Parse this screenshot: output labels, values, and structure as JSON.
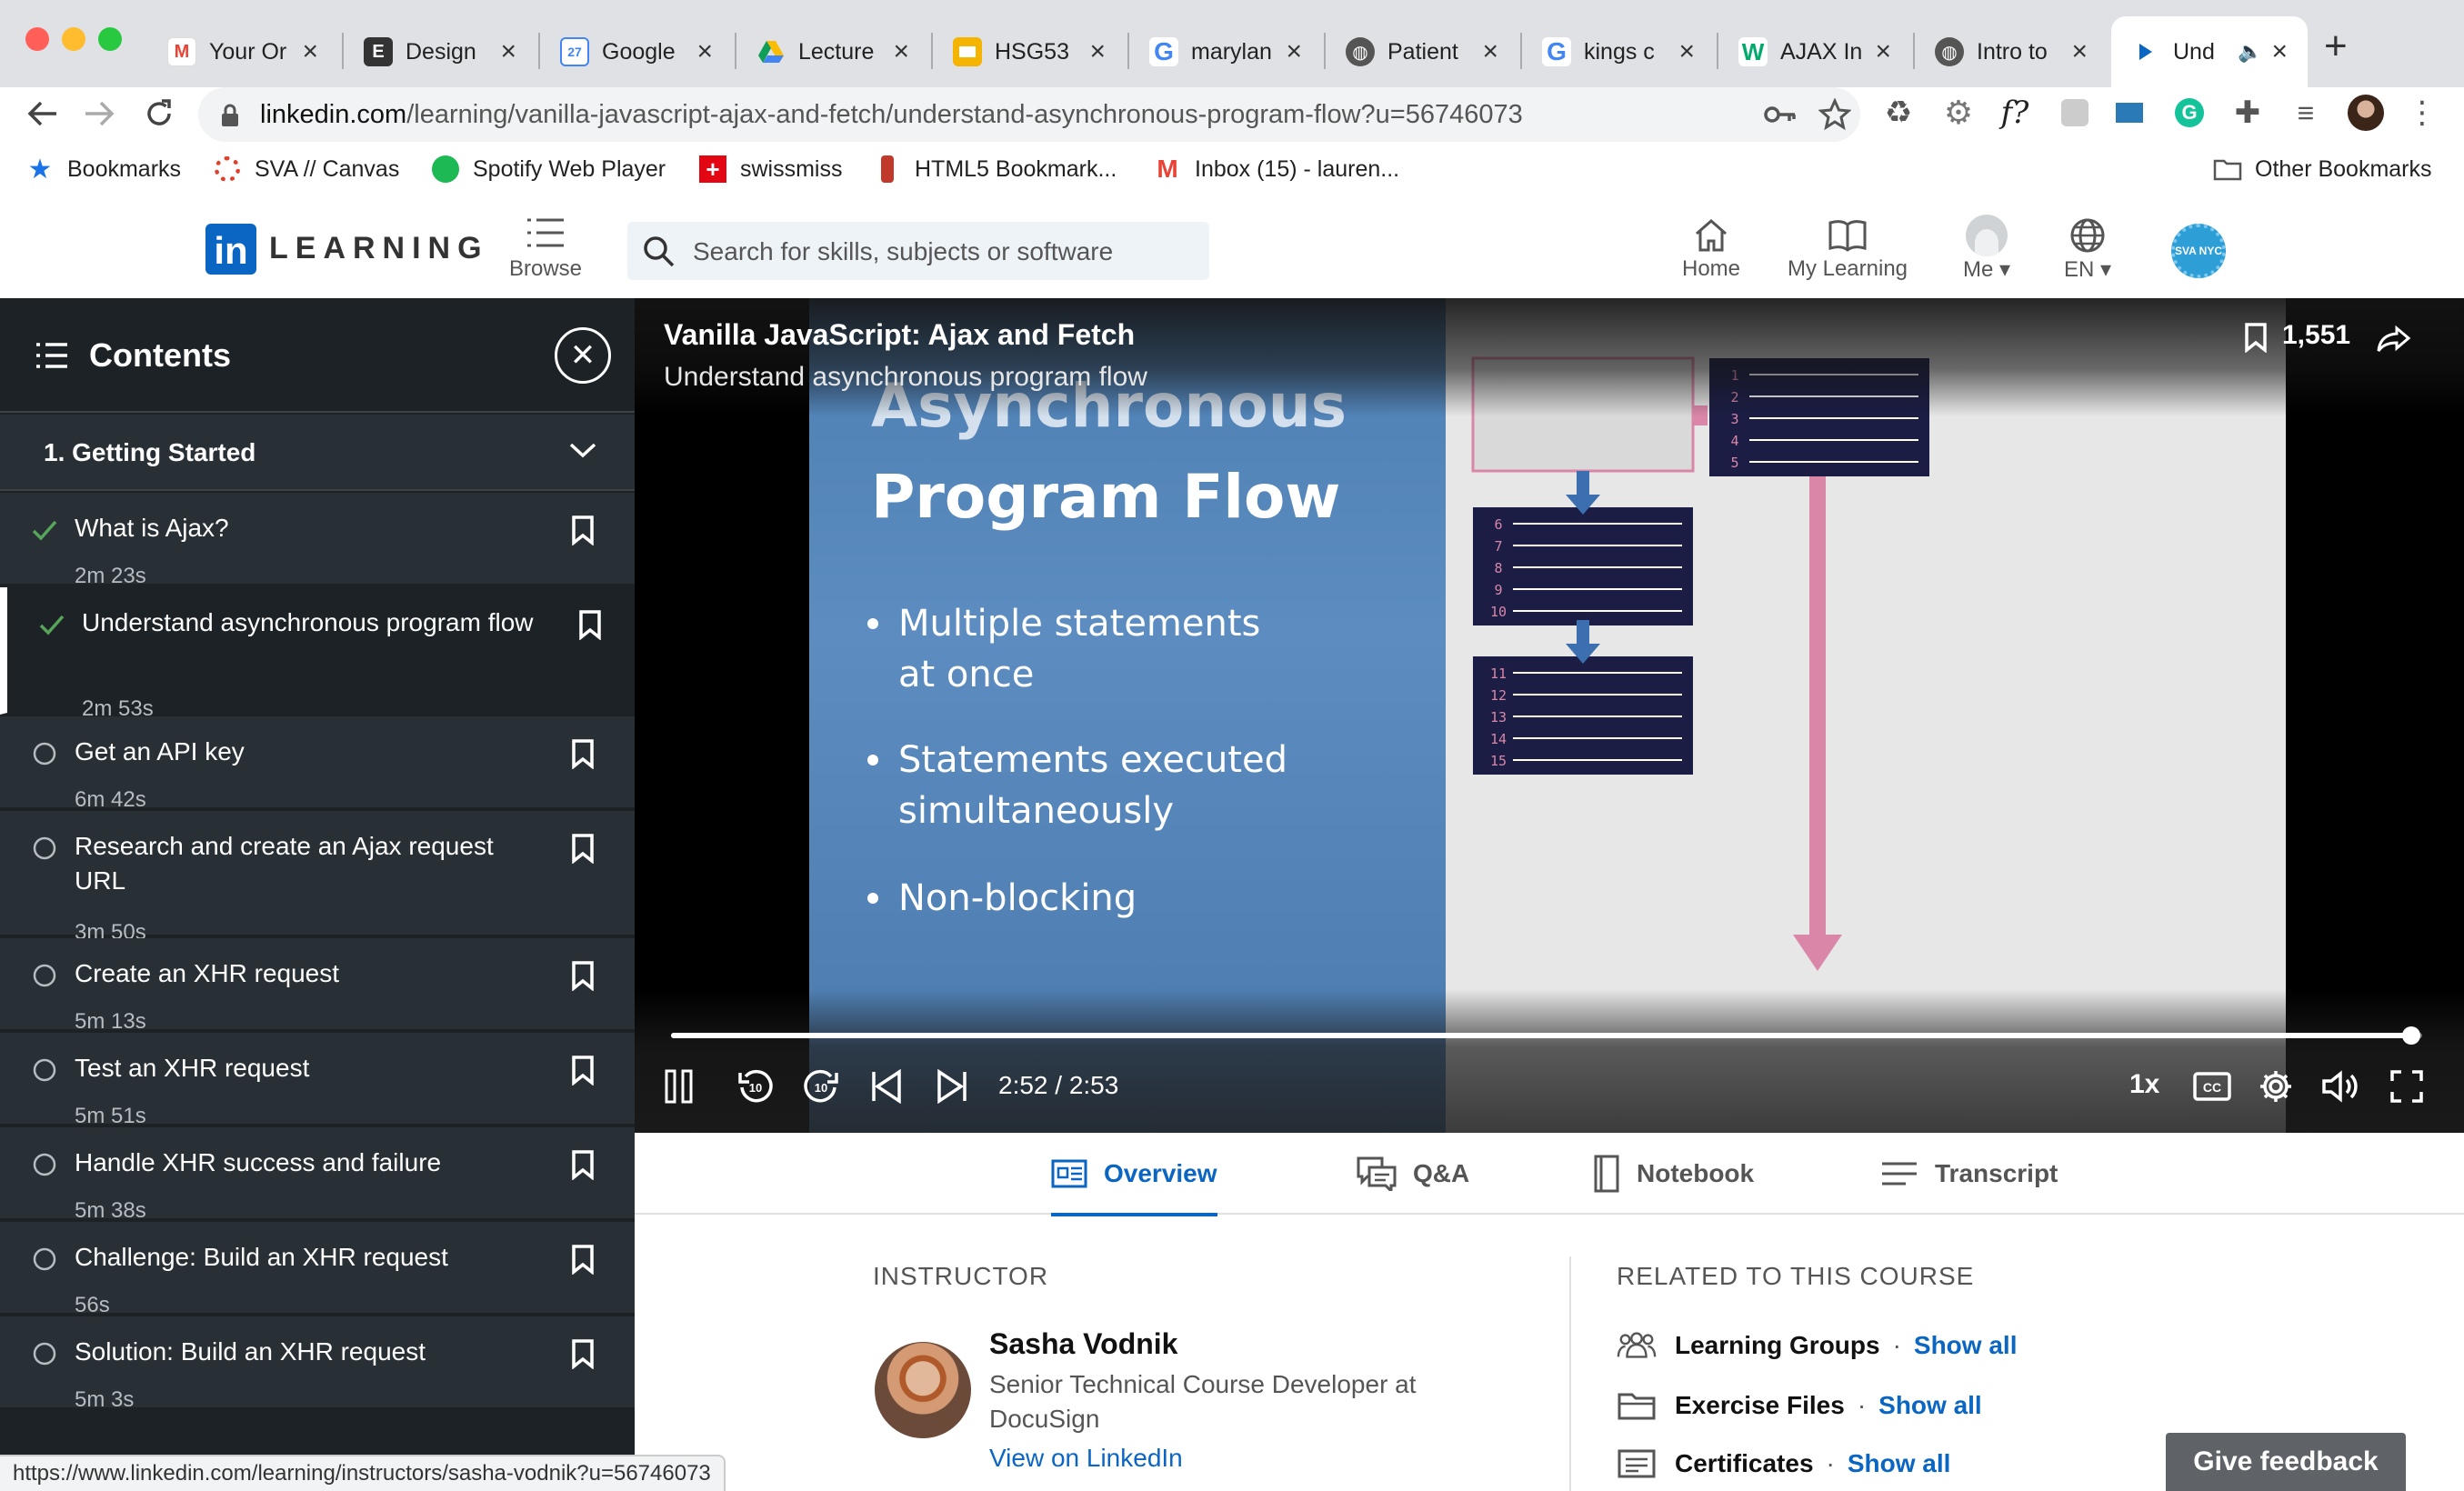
{
  "browser": {
    "tabs": [
      {
        "label": "Your Or",
        "icon": "gmail-icon",
        "color": "#ea4335"
      },
      {
        "label": "Design",
        "icon": "eater-icon",
        "color": "#333333"
      },
      {
        "label": "Google",
        "icon": "google-calendar-icon",
        "color": "#4285f4"
      },
      {
        "label": "Lecture",
        "icon": "google-drive-icon",
        "color": "#fbbc04"
      },
      {
        "label": "HSG53",
        "icon": "google-slides-icon",
        "color": "#f4b400"
      },
      {
        "label": "marylan",
        "icon": "google-icon",
        "color": "#4285f4"
      },
      {
        "label": "Patient",
        "icon": "globe-icon",
        "color": "#444444"
      },
      {
        "label": "kings c",
        "icon": "google-icon",
        "color": "#4285f4"
      },
      {
        "label": "AJAX In",
        "icon": "w3schools-icon",
        "color": "#04aa6d"
      },
      {
        "label": "Intro to",
        "icon": "globe-icon",
        "color": "#444444"
      },
      {
        "label": "Und",
        "icon": "linkedin-learning-icon",
        "color": "#0a66c2"
      }
    ],
    "url_host": "linkedin.com",
    "url_path": "/learning/vanilla-javascript-ajax-and-fetch/understand-asynchronous-program-flow?u=56746073",
    "bookmarks": [
      {
        "label": "Bookmarks",
        "icon": "star-icon"
      },
      {
        "label": "SVA // Canvas",
        "icon": "canvas-icon"
      },
      {
        "label": "Spotify Web Player",
        "icon": "spotify-icon"
      },
      {
        "label": "swissmiss",
        "icon": "swiss-flag-icon"
      },
      {
        "label": "HTML5 Bookmark...",
        "icon": "bookmarklet-icon"
      },
      {
        "label": "Inbox (15) - lauren...",
        "icon": "gmail-icon"
      },
      {
        "label": "Other Bookmarks",
        "icon": "folder-icon"
      }
    ],
    "status_url": "https://www.linkedin.com/learning/instructors/sasha-vodnik?u=56746073"
  },
  "header": {
    "logo_in": "in",
    "logo_word": "LEARNING",
    "browse": "Browse",
    "search_placeholder": "Search for skills, subjects or software",
    "nav": [
      {
        "label": "Home",
        "icon": "home-icon"
      },
      {
        "label": "My Learning",
        "icon": "book-icon"
      },
      {
        "label": "Me",
        "icon": "avatar-icon"
      },
      {
        "label": "EN",
        "icon": "globe-icon"
      }
    ],
    "org_badge": "SVA NYC"
  },
  "sidebar": {
    "title": "Contents",
    "chapter": "1. Getting Started",
    "lessons": [
      {
        "title": "What is Ajax?",
        "duration": "2m 23s",
        "status": "complete"
      },
      {
        "title": "Understand asynchronous program flow",
        "duration": "2m 53s",
        "status": "complete"
      },
      {
        "title": "Get an API key",
        "duration": "6m 42s",
        "status": "incomplete"
      },
      {
        "title": "Research and create an Ajax request URL",
        "duration": "3m 50s",
        "status": "incomplete"
      },
      {
        "title": "Create an XHR request",
        "duration": "5m 13s",
        "status": "incomplete"
      },
      {
        "title": "Test an XHR request",
        "duration": "5m 51s",
        "status": "incomplete"
      },
      {
        "title": "Handle XHR success and failure",
        "duration": "5m 38s",
        "status": "incomplete"
      },
      {
        "title": "Challenge: Build an XHR request",
        "duration": "56s",
        "status": "incomplete"
      },
      {
        "title": "Solution: Build an XHR request",
        "duration": "5m 3s",
        "status": "incomplete"
      }
    ]
  },
  "player": {
    "course_title": "Vanilla JavaScript: Ajax and Fetch",
    "video_title": "Understand asynchronous program flow",
    "saves_count": "1,551",
    "slide": {
      "heading_1": "Asynchronous",
      "heading_2": "Program Flow",
      "bullets": [
        [
          "Multiple statements",
          "at once"
        ],
        [
          "Statements executed",
          "simultaneously"
        ],
        [
          "Non-blocking"
        ]
      ],
      "line_numbers": [
        "1",
        "2",
        "3",
        "4",
        "5",
        "6",
        "7",
        "8",
        "9",
        "10",
        "11",
        "12",
        "13",
        "14",
        "15"
      ]
    },
    "time": "2:52 / 2:53",
    "progress_fraction": 0.994,
    "speed": "1x"
  },
  "content_tabs": [
    {
      "label": "Overview",
      "icon": "overview-icon",
      "active": true
    },
    {
      "label": "Q&A",
      "icon": "qa-icon",
      "active": false
    },
    {
      "label": "Notebook",
      "icon": "notebook-icon",
      "active": false
    },
    {
      "label": "Transcript",
      "icon": "transcript-icon",
      "active": false
    }
  ],
  "overview": {
    "instructor_heading": "INSTRUCTOR",
    "instructor_name": "Sasha Vodnik",
    "instructor_role": "Senior Technical Course Developer at DocuSign",
    "instructor_link": "View on LinkedIn",
    "related_heading": "RELATED TO THIS COURSE",
    "related": [
      {
        "label": "Learning Groups",
        "link": "Show all",
        "icon": "groups-icon"
      },
      {
        "label": "Exercise Files",
        "link": "Show all",
        "icon": "folder-icon"
      },
      {
        "label": "Certificates",
        "link": "Show all",
        "icon": "certificate-icon"
      }
    ],
    "separator": "·"
  },
  "feedback_label": "Give feedback",
  "colors": {
    "accent": "#0a66c2",
    "sidebar_bg": "#1d2226",
    "check": "#57a55a",
    "slide_pink": "#d986a9",
    "slide_navy": "#1b1d44"
  }
}
